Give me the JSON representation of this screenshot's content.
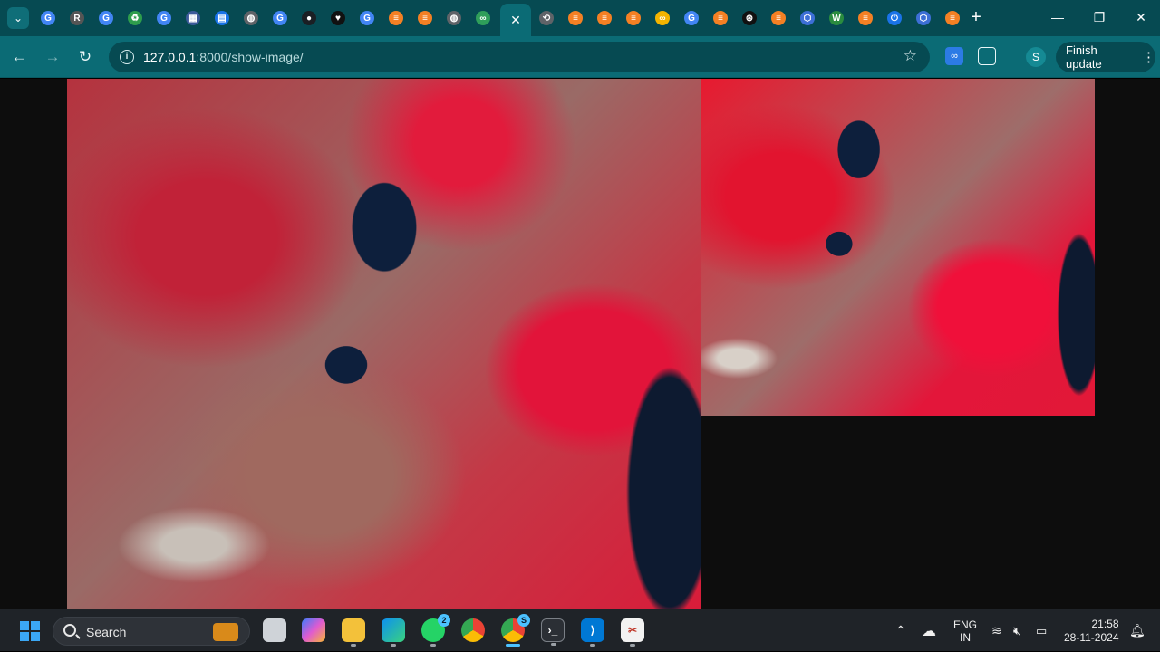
{
  "browser": {
    "tabs": [
      {
        "icon": "google-icon",
        "color": "#4285f4",
        "glyph": "G"
      },
      {
        "icon": "r-document-icon",
        "color": "#555555",
        "glyph": "R"
      },
      {
        "icon": "google-icon",
        "color": "#4285f4",
        "glyph": "G"
      },
      {
        "icon": "recycle-icon",
        "color": "#2e9d4c",
        "glyph": "♻"
      },
      {
        "icon": "google-icon",
        "color": "#4285f4",
        "glyph": "G"
      },
      {
        "icon": "app-icon",
        "color": "#3c5a9a",
        "glyph": "▦"
      },
      {
        "icon": "document-icon",
        "color": "#1a73e8",
        "glyph": "▤"
      },
      {
        "icon": "globe-icon",
        "color": "#5f6368",
        "glyph": "◍"
      },
      {
        "icon": "google-icon",
        "color": "#4285f4",
        "glyph": "G"
      },
      {
        "icon": "github-icon",
        "color": "#1b1f24",
        "glyph": "●"
      },
      {
        "icon": "shield-icon",
        "color": "#111111",
        "glyph": "♥"
      },
      {
        "icon": "google-icon",
        "color": "#4285f4",
        "glyph": "G"
      },
      {
        "icon": "stackoverflow-icon",
        "color": "#f48024",
        "glyph": "≡"
      },
      {
        "icon": "stackoverflow-icon",
        "color": "#f48024",
        "glyph": "≡"
      },
      {
        "icon": "globe-icon",
        "color": "#5f6368",
        "glyph": "◍"
      },
      {
        "icon": "infinity-icon",
        "color": "#2f9e5a",
        "glyph": "∞"
      }
    ],
    "tabs_after_active": [
      {
        "icon": "history-icon",
        "color": "#5f6368",
        "glyph": "⟲"
      },
      {
        "icon": "stackoverflow-icon",
        "color": "#f48024",
        "glyph": "≡"
      },
      {
        "icon": "stackoverflow-icon",
        "color": "#f48024",
        "glyph": "≡"
      },
      {
        "icon": "stackoverflow-icon",
        "color": "#f48024",
        "glyph": "≡"
      },
      {
        "icon": "infinity-icon",
        "color": "#f4b400",
        "glyph": "∞"
      },
      {
        "icon": "google-icon",
        "color": "#4285f4",
        "glyph": "G"
      },
      {
        "icon": "stackoverflow-icon",
        "color": "#f48024",
        "glyph": "≡"
      },
      {
        "icon": "chatgpt-icon",
        "color": "#111111",
        "glyph": "⊛"
      },
      {
        "icon": "stackoverflow-icon",
        "color": "#f48024",
        "glyph": "≡"
      },
      {
        "icon": "cube-icon",
        "color": "#3d6fd6",
        "glyph": "⬡"
      },
      {
        "icon": "w-icon",
        "color": "#2a8c3f",
        "glyph": "W"
      },
      {
        "icon": "stackoverflow-icon",
        "color": "#f48024",
        "glyph": "≡"
      },
      {
        "icon": "power-icon",
        "color": "#1a73e8",
        "glyph": "⏻"
      },
      {
        "icon": "cube-icon",
        "color": "#3d6fd6",
        "glyph": "⬡"
      },
      {
        "icon": "stackoverflow-icon",
        "color": "#f48024",
        "glyph": "≡"
      }
    ],
    "url_host": "127.0.0.1",
    "url_rest": ":8000/show-image/",
    "profile_initial": "S",
    "finish_update_label": "Finish update",
    "accent": "#0b6b75",
    "tabstrip_color": "#064a52"
  },
  "taskbar": {
    "search_label": "Search",
    "whatsapp_badge": "2",
    "chrome_badge": "S",
    "language_line1": "ENG",
    "language_line2": "IN",
    "time": "21:58",
    "date": "28-11-2024"
  }
}
